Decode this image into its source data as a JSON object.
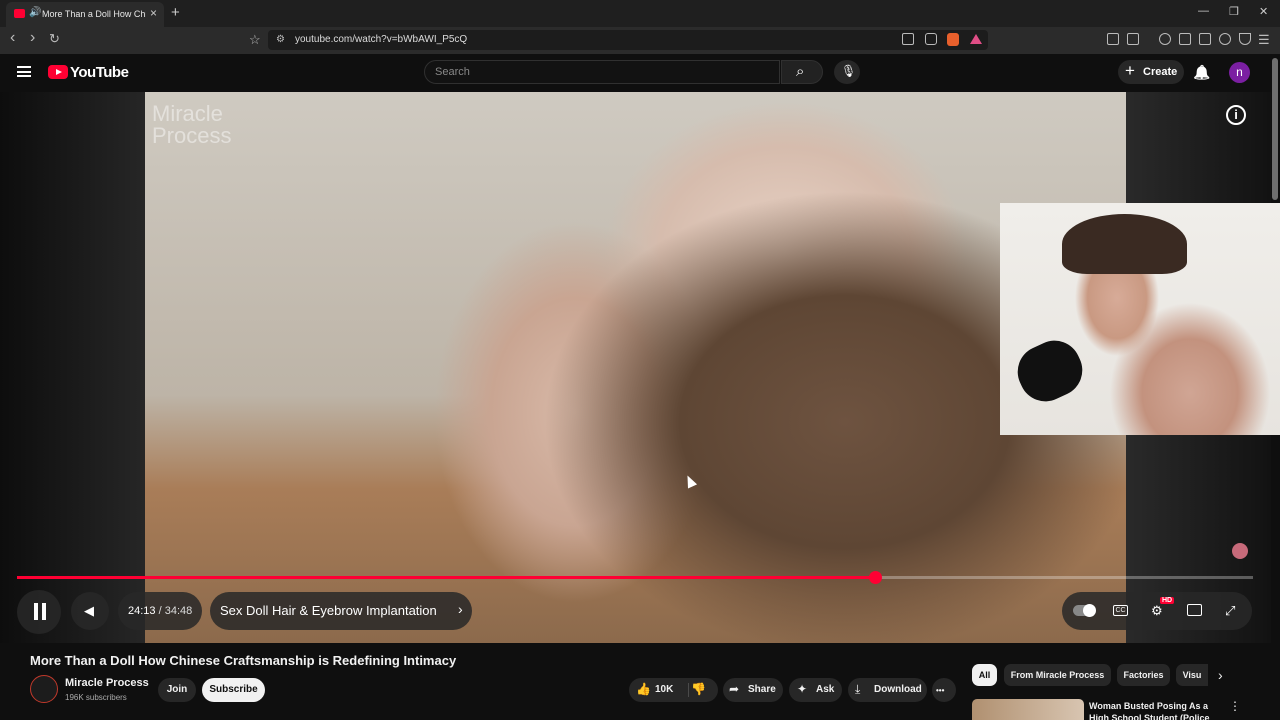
{
  "browser": {
    "tab_title": "More Than a Doll How Chinese Craftsmanship is Redefining Intimacy",
    "tab_close": "×",
    "new_tab": "+",
    "url": "youtube.com/watch?v=bWbAWI_P5cQ",
    "window_controls": {
      "minimize": "—",
      "restore": "❐",
      "close": "✕"
    },
    "nav": {
      "back": "‹",
      "forward": "›",
      "reload": "↻",
      "bookmark": "☆"
    }
  },
  "youtube": {
    "logo_text": "YouTube",
    "search_placeholder": "Search",
    "create_label": "Create",
    "create_plus": "+",
    "avatar_letter": "n",
    "bell": "🔔",
    "search_icon": "⌕",
    "mic_icon": "🎙"
  },
  "player": {
    "watermark_line1": "Miracle",
    "watermark_line2": "Process",
    "info": "i",
    "progress_fraction": 0.6938,
    "current_time": "24:13",
    "time_separator": " / ",
    "duration": "34:48",
    "chapter": "Sex Doll Hair & Eyebrow Implantation",
    "chapter_arrow": "›",
    "cc_label": "CC",
    "hd_badge": "HD",
    "settings_icon": "⚙",
    "fullscreen_icon": "⤢",
    "volume_icon": "◀"
  },
  "video": {
    "title": "More Than a Doll How Chinese Craftsmanship is Redefining Intimacy",
    "channel_name": "Miracle Process",
    "subscribers": "196K subscribers",
    "join_label": "Join",
    "subscribe_label": "Subscribe",
    "like_count": "10K",
    "share_label": "Share",
    "ask_label": "Ask",
    "download_label": "Download",
    "more": "•••"
  },
  "chips": [
    "All",
    "From Miracle Process",
    "Factories",
    "Visu"
  ],
  "recommended": {
    "title": "Woman Busted Posing As a High School Student (Police",
    "more": "⋮"
  },
  "colors": {
    "accent": "#ff0033",
    "background": "#0f0f0f",
    "avatar": "#7b1fa2"
  }
}
